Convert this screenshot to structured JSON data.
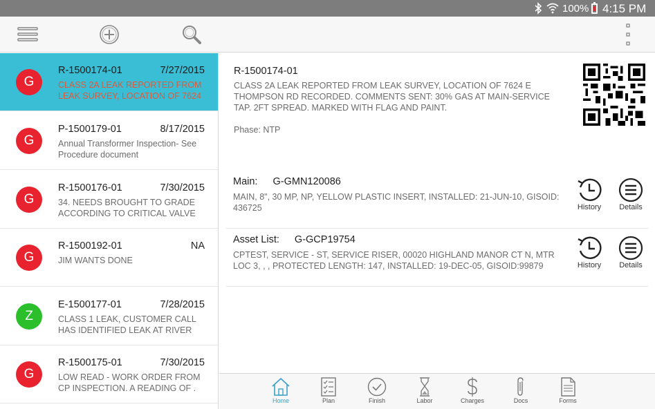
{
  "status_bar": {
    "battery_pct": "100%",
    "time": "4:15 PM"
  },
  "toolbar": {
    "menu_icon": "hamburger-menu-icon",
    "add_icon": "add-circle-icon",
    "search_icon": "search-icon",
    "more_icon": "more-vertical-icon"
  },
  "colors": {
    "selected_row": "#39bed5",
    "avatar_red": "#e8232f",
    "avatar_green": "#2bbf2b",
    "accent_active": "#3aa0c8"
  },
  "work_orders": [
    {
      "badge": "G",
      "badge_color": "#e8232f",
      "id": "R-1500174-01",
      "date": "7/27/2015",
      "description": "CLASS 2A LEAK REPORTED FROM LEAK SURVEY, LOCATION OF 7624"
    },
    {
      "badge": "G",
      "badge_color": "#e8232f",
      "id": "P-1500179-01",
      "date": "8/17/2015",
      "description": "Annual Transformer Inspection- See Procedure document"
    },
    {
      "badge": "G",
      "badge_color": "#e8232f",
      "id": "R-1500176-01",
      "date": "7/30/2015",
      "description": "34. NEEDS BROUGHT TO GRADE ACCORDING TO CRITICAL VALVE"
    },
    {
      "badge": "G",
      "badge_color": "#e8232f",
      "id": "R-1500192-01",
      "date": "NA",
      "description": "JIM WANTS DONE"
    },
    {
      "badge": "Z",
      "badge_color": "#2bbf2b",
      "id": "E-1500177-01",
      "date": "7/28/2015",
      "description": "CLASS 1 LEAK, CUSTOMER CALL HAS IDENTIFIED LEAK AT RIVER"
    },
    {
      "badge": "G",
      "badge_color": "#e8232f",
      "id": "R-1500175-01",
      "date": "7/30/2015",
      "description": "LOW READ - WORK ORDER FROM CP INSPECTION. A READING OF ."
    }
  ],
  "detail": {
    "id": "R-1500174-01",
    "description": "CLASS 2A LEAK REPORTED FROM LEAK SURVEY, LOCATION OF 7624 E THOMPSON RD RECORDED. COMMENTS SENT: 30% GAS AT MAIN-SERVICE TAP. 2FT SPREAD. MARKED WITH FLAG AND PAINT.",
    "phase": "Phase: NTP",
    "main": {
      "label": "Main:",
      "code": "G-GMN120086",
      "description": "MAIN, 8\", 30 MP, NP, YELLOW PLASTIC INSERT, INSTALLED: 21-JUN-10, GISOID: 436725"
    },
    "asset_list": {
      "label": "Asset List:",
      "code": "G-GCP19754",
      "description": "CPTEST, SERVICE - ST, SERVICE RISER, 00020 HIGHLAND MANOR CT N, MTR LOC 3, , , PROTECTED LENGTH: 147, INSTALLED: 19-DEC-05, GISOID:99879"
    },
    "actions": {
      "history": "History",
      "details": "Details"
    }
  },
  "bottom_nav": {
    "home": "Home",
    "plan": "Plan",
    "finish": "Finish",
    "labor": "Labor",
    "charges": "Charges",
    "docs": "Docs",
    "forms": "Forms",
    "active": "Home"
  }
}
